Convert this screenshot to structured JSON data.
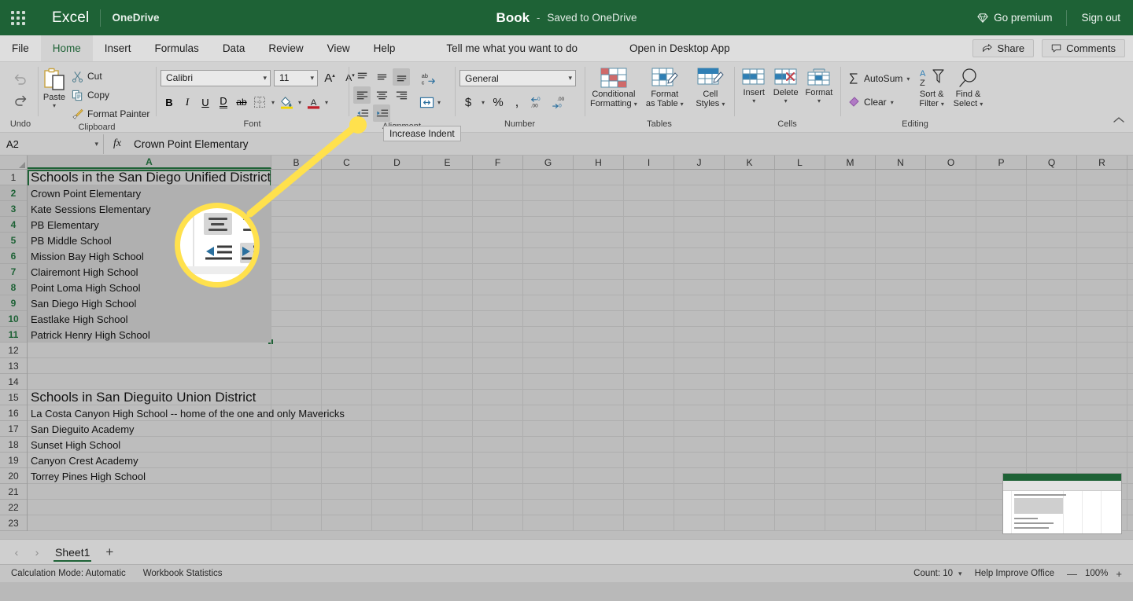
{
  "titlebar": {
    "app_name": "Excel",
    "location": "OneDrive",
    "doc_title": "Book",
    "doc_dash": "-",
    "doc_saved": "Saved to OneDrive",
    "go_premium": "Go premium",
    "sign_out": "Sign out",
    "brand_color": "#1e6236"
  },
  "tabs": [
    {
      "label": "File"
    },
    {
      "label": "Home"
    },
    {
      "label": "Insert"
    },
    {
      "label": "Formulas"
    },
    {
      "label": "Data"
    },
    {
      "label": "Review"
    },
    {
      "label": "View"
    },
    {
      "label": "Help"
    },
    {
      "label": "Tell me what you want to do"
    },
    {
      "label": "Open in Desktop App"
    }
  ],
  "tabs_right": {
    "share": "Share",
    "comments": "Comments"
  },
  "ribbon": {
    "undo": {
      "label": "Undo"
    },
    "clipboard": {
      "group_label": "Clipboard",
      "paste": "Paste",
      "cut": "Cut",
      "copy": "Copy",
      "format_painter": "Format Painter"
    },
    "font": {
      "group_label": "Font",
      "font_name": "Calibri",
      "font_size": "11",
      "grow_font": "A",
      "shrink_font": "A",
      "bold": "B",
      "italic": "I",
      "underline": "U",
      "double_underline": "D",
      "strikethrough": "ab"
    },
    "alignment": {
      "group_label": "Alignment",
      "wrap_text": "ab",
      "merge": "merge"
    },
    "number": {
      "group_label": "Number",
      "format": "General",
      "currency": "$",
      "percent": "%",
      "comma": ",",
      "increase_decimal": ".00",
      "decrease_decimal": ".00"
    },
    "tables": {
      "group_label": "Tables",
      "conditional_formatting_l1": "Conditional",
      "conditional_formatting_l2": "Formatting",
      "format_as_table_l1": "Format",
      "format_as_table_l2": "as Table",
      "cell_styles_l1": "Cell",
      "cell_styles_l2": "Styles"
    },
    "cells": {
      "group_label": "Cells",
      "insert": "Insert",
      "delete": "Delete",
      "format": "Format"
    },
    "editing": {
      "group_label": "Editing",
      "autosum": "AutoSum",
      "clear": "Clear",
      "sort_filter_l1": "Sort &",
      "sort_filter_l2": "Filter",
      "find_select_l1": "Find &",
      "find_select_l2": "Select"
    }
  },
  "formula_bar": {
    "name_box": "A2",
    "fx": "fx",
    "content": "Crown Point Elementary"
  },
  "grid": {
    "columns": [
      "A",
      "B",
      "C",
      "D",
      "E",
      "F",
      "G",
      "H",
      "I",
      "J",
      "K",
      "L",
      "M",
      "N",
      "O",
      "P",
      "Q",
      "R"
    ],
    "selected_column": "A",
    "selected_rows": [
      2,
      3,
      4,
      5,
      6,
      7,
      8,
      9,
      10,
      11
    ],
    "rows": [
      {
        "n": 1,
        "a": "Schools in the San Diego Unified District",
        "big": true
      },
      {
        "n": 2,
        "a": "Crown Point Elementary"
      },
      {
        "n": 3,
        "a": "Kate Sessions Elementary"
      },
      {
        "n": 4,
        "a": "PB Elementary"
      },
      {
        "n": 5,
        "a": "PB Middle School"
      },
      {
        "n": 6,
        "a": "Mission Bay High School"
      },
      {
        "n": 7,
        "a": "Clairemont High School"
      },
      {
        "n": 8,
        "a": "Point Loma High School"
      },
      {
        "n": 9,
        "a": "San Diego High School"
      },
      {
        "n": 10,
        "a": "Eastlake High School"
      },
      {
        "n": 11,
        "a": "Patrick Henry High School"
      },
      {
        "n": 12,
        "a": ""
      },
      {
        "n": 13,
        "a": ""
      },
      {
        "n": 14,
        "a": ""
      },
      {
        "n": 15,
        "a": "Schools in San Dieguito Union District",
        "big": true
      },
      {
        "n": 16,
        "a": "La Costa Canyon High School -- home of the one and only Mavericks"
      },
      {
        "n": 17,
        "a": "San Dieguito Academy"
      },
      {
        "n": 18,
        "a": "Sunset High School"
      },
      {
        "n": 19,
        "a": "Canyon Crest Academy"
      },
      {
        "n": 20,
        "a": "Torrey Pines High School"
      },
      {
        "n": 21,
        "a": ""
      },
      {
        "n": 22,
        "a": ""
      },
      {
        "n": 23,
        "a": ""
      }
    ]
  },
  "sheet_bar": {
    "prev": "‹",
    "next": "›",
    "sheets": [
      {
        "label": "Sheet1",
        "active": true
      }
    ],
    "add": "+"
  },
  "status_bar": {
    "calc_mode": "Calculation Mode: Automatic",
    "workbook_stats": "Workbook Statistics",
    "count": "Count: 10",
    "help_improve": "Help Improve Office",
    "zoom_out": "—",
    "zoom_level": "100%",
    "zoom_in": "+"
  },
  "callout": {
    "tooltip": "Increase Indent",
    "highlight_color": "#ffe14d"
  }
}
